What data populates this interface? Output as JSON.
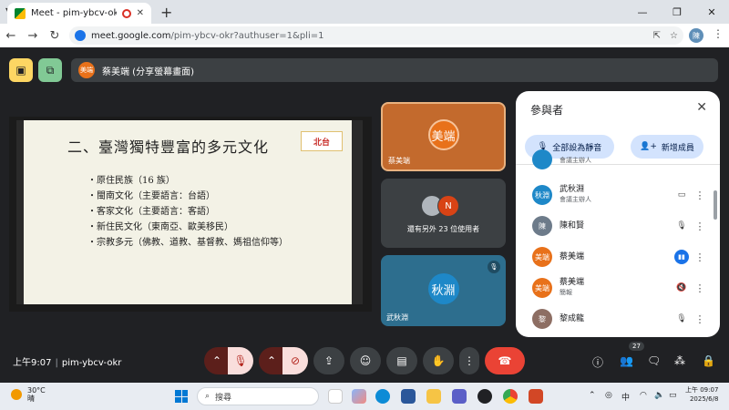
{
  "browser": {
    "tab_title": "Meet - pim-ybcv-okr",
    "tab_close": "✕",
    "new_tab": "+",
    "url_host": "meet.google.com",
    "url_path": "/pim-ybcv-okr?authuser=1&pli=1",
    "profile_initial": "陳"
  },
  "meet_top": {
    "presenter_avatar": "美端",
    "presenter_label": "蔡美端 (分享螢幕畫面)"
  },
  "slide": {
    "title": "二、臺灣獨特豐富的多元文化",
    "logo": "北台",
    "items": [
      "・原住民族（16 族）",
      "・閩南文化（主要語言：台語）",
      "・客家文化（主要語言：客語）",
      "・新住民文化（東南亞、歐美移民）",
      "・宗教多元（佛教、道教、基督教、媽祖信仰等）"
    ]
  },
  "tiles": {
    "tile1": {
      "avatar": "美端",
      "name": "蔡美端"
    },
    "tile2": {
      "avatar_b": "N",
      "label": "還有另外 23 位使用者"
    },
    "tile3": {
      "avatar": "秋淵",
      "name": "武秋淵"
    }
  },
  "panel": {
    "title": "參與者",
    "mute_all": "全部設為靜音",
    "add_people": "新增成員",
    "top_partial": "會議主辦人",
    "participants": [
      {
        "avatar": "秋淵",
        "name": "武秋淵",
        "sub": "會議主辦人",
        "color": "#1e88c8"
      },
      {
        "avatar": "陳",
        "name": "陳和賢",
        "sub": "",
        "color": "#6d7b8a"
      },
      {
        "avatar": "美端",
        "name": "蔡美端",
        "sub": "",
        "color": "#e8711a"
      },
      {
        "avatar": "美端",
        "name": "蔡美端",
        "sub": "簡報",
        "color": "#e8711a"
      },
      {
        "avatar": "黎",
        "name": "黎成龍",
        "sub": "",
        "color": "#8d6e63"
      }
    ]
  },
  "bottom": {
    "time": "上午9:07",
    "meeting_code": "pim-ybcv-okr",
    "people_count": "27"
  },
  "taskbar": {
    "temp": "30°C",
    "weather": "晴",
    "search_placeholder": "搜尋",
    "ime": "中",
    "clock_time": "上午 09:07",
    "clock_date": "2025/6/8"
  }
}
